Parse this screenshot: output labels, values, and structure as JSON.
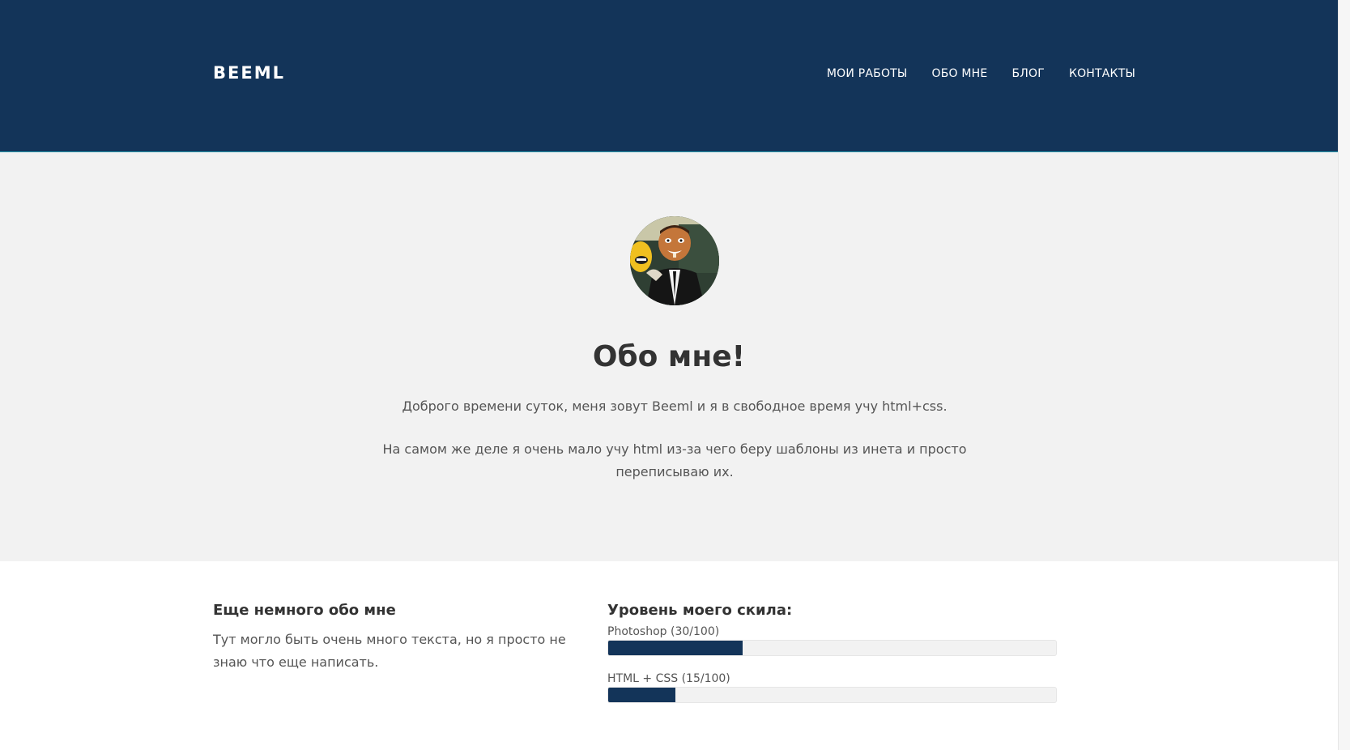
{
  "header": {
    "logo": "BEEML",
    "nav": [
      "МОИ РАБОТЫ",
      "ОБО МНЕ",
      "БЛОГ",
      "КОНТАКТЫ"
    ]
  },
  "about": {
    "title": "Обо мне!",
    "paragraph1": "Доброго времени суток, меня зовут Beeml и я в свободное время учу html+css.",
    "paragraph2": "На самом же деле я очень мало учу html из-за чего беру шаблоны из инета и просто переписываю их."
  },
  "more": {
    "heading": "Еще немного обо мне",
    "text": "Тут могло быть очень много текста, но я просто не знаю что еще написать."
  },
  "skills": {
    "heading": "Уровень моего скила:",
    "items": [
      {
        "label": "Photoshop (30/100)",
        "value": 30
      },
      {
        "label": "HTML + CSS (15/100)",
        "value": 15
      }
    ]
  },
  "colors": {
    "header_bg": "#133459",
    "accent": "#133459",
    "section_bg": "#f2f2f2"
  }
}
